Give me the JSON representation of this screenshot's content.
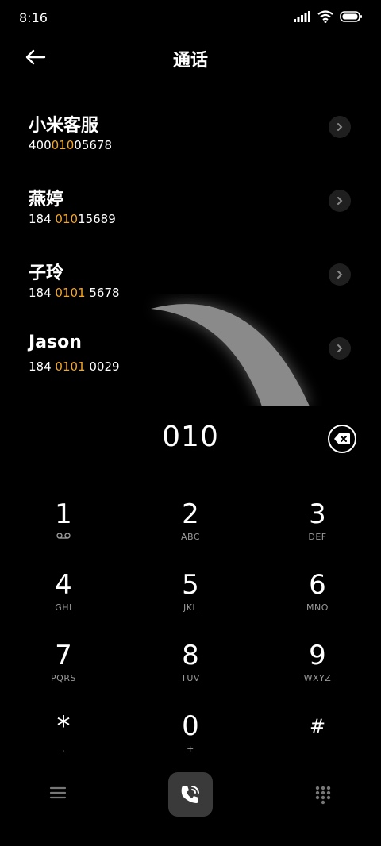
{
  "status_bar": {
    "time": "8:16",
    "icons": [
      "signal-icon",
      "wifi-icon",
      "battery-icon"
    ]
  },
  "header": {
    "title": "通话",
    "back_icon": "arrow-left-icon"
  },
  "contacts": [
    {
      "name": "小米客服",
      "number_pre": "400",
      "number_match": "010",
      "number_post": "05678"
    },
    {
      "name": "燕婷",
      "number_pre": "184 ",
      "number_match": "010",
      "number_post": "15689"
    },
    {
      "name": "子玲",
      "number_pre": "184 ",
      "number_match": "0101",
      "number_post": " 5678"
    },
    {
      "name": "Jason",
      "number_pre": "184 ",
      "number_match": "0101",
      "number_post": " 0029"
    }
  ],
  "dialed": "010",
  "keypad": [
    {
      "digit": "1",
      "sub": "",
      "sub_icon": "voicemail-icon"
    },
    {
      "digit": "2",
      "sub": "ABC"
    },
    {
      "digit": "3",
      "sub": "DEF"
    },
    {
      "digit": "4",
      "sub": "GHI"
    },
    {
      "digit": "5",
      "sub": "JKL"
    },
    {
      "digit": "6",
      "sub": "MNO"
    },
    {
      "digit": "7",
      "sub": "PQRS"
    },
    {
      "digit": "8",
      "sub": "TUV"
    },
    {
      "digit": "9",
      "sub": "WXYZ"
    },
    {
      "digit": "*",
      "sub": ","
    },
    {
      "digit": "0",
      "sub": "+"
    },
    {
      "digit": "#",
      "sub": ""
    }
  ],
  "colors": {
    "background": "#000000",
    "highlight": "#f5a623",
    "call_button": "#3a3a3a",
    "key_sub": "#9a9a9a"
  }
}
